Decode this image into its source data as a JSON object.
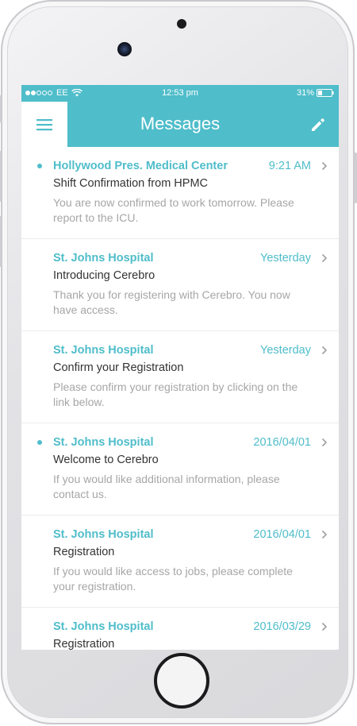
{
  "status_bar": {
    "carrier": "EE",
    "time": "12:53 pm",
    "battery": "31%",
    "signal_bars_filled": 2,
    "signal_bars_total": 5,
    "battery_level": 0.31
  },
  "header": {
    "title": "Messages",
    "menu_icon": "hamburger-menu-icon",
    "edit_icon": "pencil-icon"
  },
  "colors": {
    "accent": "#4fbdca",
    "subject_text": "#333333",
    "preview_text": "#a6a6a6"
  },
  "messages": [
    {
      "unread": true,
      "sender": "Hollywood Pres. Medical Center",
      "date": "9:21 AM",
      "subject": "Shift Confirmation from HPMC",
      "preview": "You are now confirmed to work tomorrow. Please report to the ICU."
    },
    {
      "unread": false,
      "sender": "St. Johns Hospital",
      "date": "Yesterday",
      "subject": "Introducing Cerebro",
      "preview": "Thank you for registering with Cerebro. You now have access."
    },
    {
      "unread": false,
      "sender": "St. Johns Hospital",
      "date": "Yesterday",
      "subject": "Confirm your Registration",
      "preview": "Please confirm your registration by clicking on the link below."
    },
    {
      "unread": true,
      "sender": "St. Johns Hospital",
      "date": "2016/04/01",
      "subject": "Welcome to Cerebro",
      "preview": "If you would like additional information, please contact us."
    },
    {
      "unread": false,
      "sender": "St. Johns Hospital",
      "date": "2016/04/01",
      "subject": "Registration",
      "preview": "If you would like access to jobs, please complete your registration."
    },
    {
      "unread": false,
      "sender": "St. Johns Hospital",
      "date": "2016/03/29",
      "subject": "Registration",
      "preview": ""
    }
  ]
}
